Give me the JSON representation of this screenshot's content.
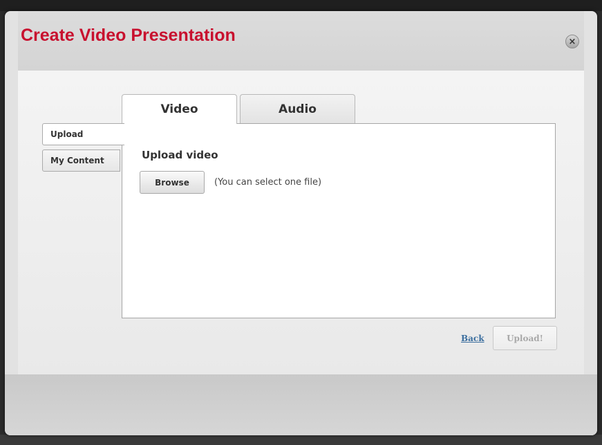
{
  "dialog": {
    "title": "Create Video Presentation",
    "close_icon": "×"
  },
  "tabs": [
    {
      "label": "Video",
      "active": true
    },
    {
      "label": "Audio",
      "active": false
    }
  ],
  "side_tabs": [
    {
      "label": "Upload",
      "active": true
    },
    {
      "label": "My Content",
      "active": false
    }
  ],
  "upload": {
    "section_title": "Upload video",
    "browse_label": "Browse",
    "hint": "(You can select one file)"
  },
  "footer": {
    "back_label": "Back",
    "upload_label": "Upload!"
  },
  "colors": {
    "title": "#c8102e",
    "link": "#3b6e9e"
  }
}
